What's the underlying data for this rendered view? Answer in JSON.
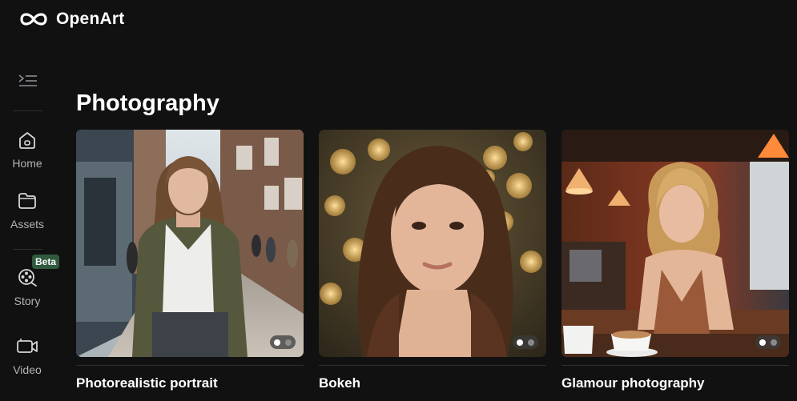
{
  "app": {
    "name": "OpenArt",
    "logo_icon": "infinity-logo-icon"
  },
  "sidebar": {
    "collapse_icon": "collapse-menu-icon",
    "items": [
      {
        "label": "Home",
        "icon": "home-icon"
      },
      {
        "label": "Assets",
        "icon": "folder-icon"
      },
      {
        "label": "Story",
        "icon": "film-reel-icon",
        "badge": "Beta"
      },
      {
        "label": "Video",
        "icon": "video-camera-icon"
      }
    ]
  },
  "section": {
    "title": "Photography",
    "cards": [
      {
        "title": "Photorealistic portrait",
        "slides": 2,
        "active_slide": 1
      },
      {
        "title": "Bokeh",
        "slides": 2,
        "active_slide": 1
      },
      {
        "title": "Glamour photography",
        "slides": 2,
        "active_slide": 1
      }
    ]
  },
  "colors": {
    "background": "#111112",
    "beta_badge": "#2f5a3e",
    "divider": "#2e2e31"
  }
}
